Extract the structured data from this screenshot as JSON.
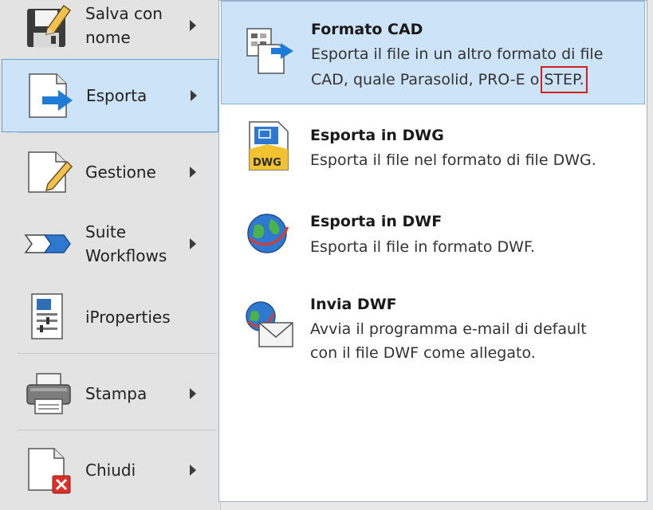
{
  "left_menu": {
    "items": [
      {
        "label": "Salva con\nnome",
        "has_arrow": true
      },
      {
        "label": "Esporta",
        "has_arrow": true,
        "selected": true
      },
      {
        "label": "Gestione",
        "has_arrow": true
      },
      {
        "label": "Suite\nWorkflows",
        "has_arrow": true
      },
      {
        "label": "iProperties",
        "has_arrow": false
      },
      {
        "label": "Stampa",
        "has_arrow": true
      },
      {
        "label": "Chiudi",
        "has_arrow": true
      }
    ]
  },
  "submenu": {
    "items": [
      {
        "title": "Formato CAD",
        "desc_line1": "Esporta il file in un altro formato di file",
        "desc_line2_pre": "CAD, quale Parasolid, PRO-E o",
        "desc_line2_highlight": "STEP.",
        "selected": true
      },
      {
        "title": "Esporta in DWG",
        "desc": "Esporta il file nel formato di file DWG.",
        "icon_text": "DWG"
      },
      {
        "title": "Esporta in DWF",
        "desc": "Esporta il file in formato DWF."
      },
      {
        "title": "Invia DWF",
        "desc_line1": "Avvia il programma e-mail di default",
        "desc_line2": "con il file DWF come allegato."
      }
    ]
  },
  "colors": {
    "selection_fill": "#cde3f7",
    "selection_border": "#6a9fd6",
    "highlight_box": "#d02020"
  }
}
